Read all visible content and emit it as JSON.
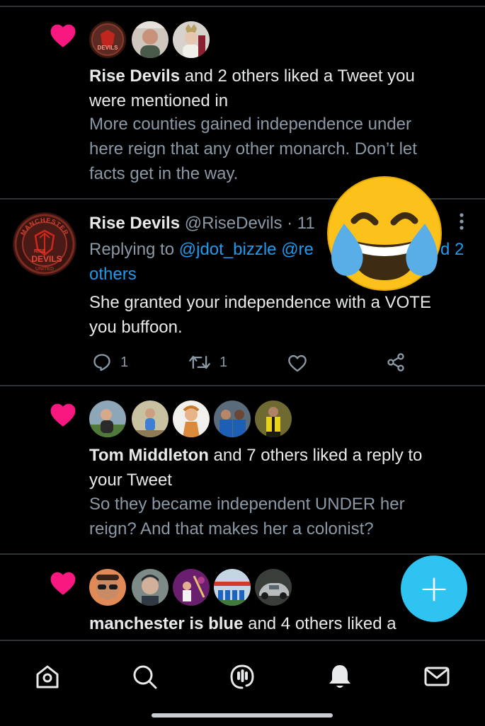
{
  "notifications": [
    {
      "type": "like",
      "actor": "Rise Devils",
      "action_line1": " and 2 others liked a Tweet you",
      "action_line2": "were mentioned in",
      "preview_lines": [
        "More counties gained independence under",
        "here reign that any other monarch. Don’t let",
        "facts get in the way."
      ]
    },
    {
      "type": "reply",
      "name": "Rise Devils",
      "handle": "@RiseDevils",
      "time": "· 11",
      "replying_to_label": "Replying to ",
      "replying_to_user": "@jdot_bizzle",
      "replying_to_partial": "@re",
      "replying_to_tail": "d 2",
      "replying_to_more": "others",
      "text_lines": [
        "She granted your independence with a VOTE",
        "you buffoon."
      ],
      "replies": "1",
      "retweets": "1"
    },
    {
      "type": "like",
      "actor": "Tom Middleton",
      "action_line1": " and 7 others liked a reply to",
      "action_line2": "your Tweet",
      "preview_lines": [
        "So they became independent UNDER her",
        "reign? And that makes her a colonist?"
      ]
    },
    {
      "type": "like",
      "actor": "manchester is blue",
      "action_line1": " and 4 others liked a"
    }
  ],
  "crest_text": {
    "arc": "MANCHESTER",
    "mid": "RISE",
    "word": "DEVILS",
    "bottom": "UNITED"
  },
  "fab_label": "+",
  "icons": {
    "heart": "heart-icon",
    "reply": "reply-icon",
    "retweet": "retweet-icon",
    "like": "like-outline-icon",
    "share": "share-icon",
    "more": "more-vertical-icon",
    "nav": [
      "home-icon",
      "search-icon",
      "spaces-icon",
      "notifications-icon",
      "messages-icon"
    ]
  },
  "colors": {
    "background": "#000000",
    "heart": "#f91880",
    "link": "#1d9bf0",
    "muted": "#8b98a5",
    "fab": "#2ec3f0"
  }
}
